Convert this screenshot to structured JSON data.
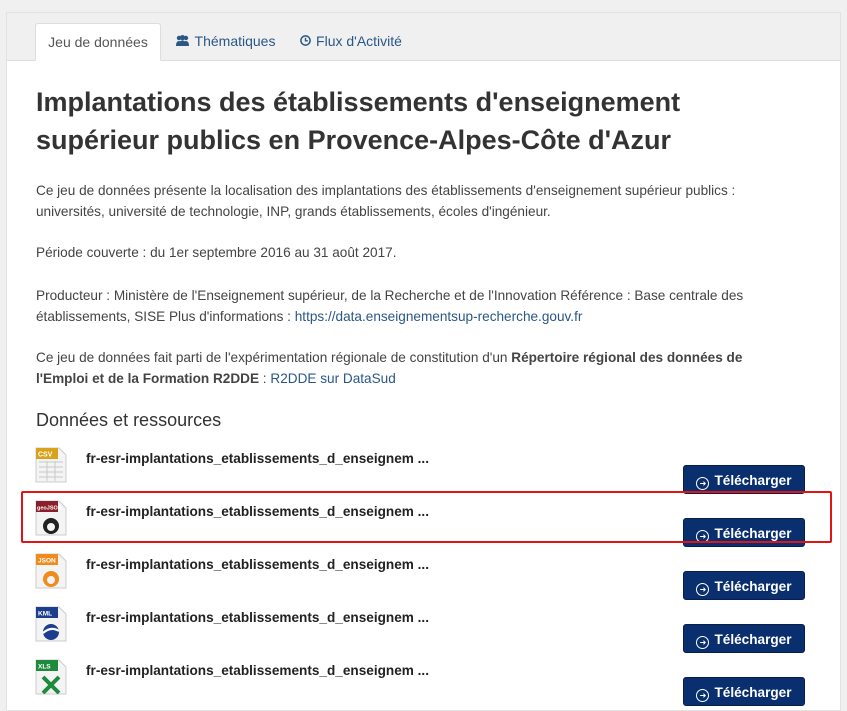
{
  "tabs": [
    {
      "label": "Jeu de données",
      "icon": "database-icon"
    },
    {
      "label": "Thématiques",
      "icon": "users-icon"
    },
    {
      "label": "Flux d'Activité",
      "icon": "clock-icon"
    }
  ],
  "title": "Implantations des établissements d'enseignement supérieur publics en Provence-Alpes-Côte d'Azur",
  "description": {
    "p1": "Ce jeu de données présente la localisation des implantations des établissements d'enseignement supérieur publics : universités, université de technologie, INP, grands établissements, écoles d'ingénieur.",
    "p2": "Période couverte : du 1er septembre 2016 au 31 août 2017.",
    "p3_text": "Producteur : Ministère de l'Enseignement supérieur, de la Recherche et de l'Innovation Référence : Base centrale des établissements, SISE Plus d'informations : ",
    "p3_link": "https://data.enseignementsup-recherche.gouv.fr",
    "p4_text": "Ce jeu de données fait parti de l'expérimentation régionale de constitution d'un ",
    "p4_bold": "Répertoire régional des données de l'Emploi et de la Formation R2DDE",
    "p4_sep": " : ",
    "p4_link": "R2DDE sur DataSud"
  },
  "section_title": "Données et ressources",
  "resources": [
    {
      "format": "CSV",
      "name": "fr-esr-implantations_etablissements_d_enseignem ...",
      "button": "Télécharger",
      "color": "#d9a21b"
    },
    {
      "format": "geoJSON",
      "name": "fr-esr-implantations_etablissements_d_enseignem ...",
      "button": "Télécharger",
      "color": "#8a1f2b"
    },
    {
      "format": "JSON",
      "name": "fr-esr-implantations_etablissements_d_enseignem ...",
      "button": "Télécharger",
      "color": "#f08a1c"
    },
    {
      "format": "KML",
      "name": "fr-esr-implantations_etablissements_d_enseignem ...",
      "button": "Télécharger",
      "color": "#1d3d8f"
    },
    {
      "format": "XLS",
      "name": "fr-esr-implantations_etablissements_d_enseignem ...",
      "button": "Télécharger",
      "color": "#1e8a3c"
    }
  ],
  "colors": {
    "accent": "#0a2f6e",
    "link": "#2a5785",
    "highlight": "#e01414"
  }
}
